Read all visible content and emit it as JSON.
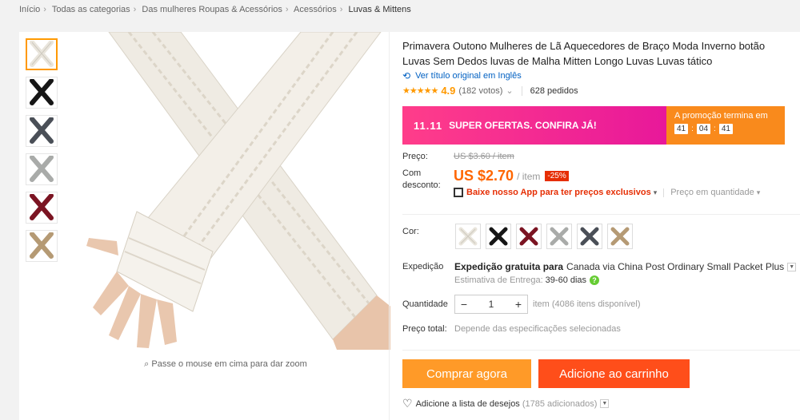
{
  "breadcrumb": {
    "items": [
      "Início",
      "Todas as categorias",
      "Das mulheres Roupas & Acessórios",
      "Acessórios"
    ],
    "current": "Luvas & Mittens",
    "separator": "›"
  },
  "gallery": {
    "thumb_colors": [
      "#f2f0ea",
      "#161616",
      "#4a4f57",
      "#a9aba9",
      "#7b1422",
      "#b59a74"
    ],
    "zoom_hint": "Passe o mouse em cima para dar zoom"
  },
  "product": {
    "title": "Primavera Outono Mulheres de Lã Aquecedores de Braço Moda Inverno botão Luvas Sem Dedos luvas de Malha Mitten Longo Luvas Luvas tático",
    "translate_link": "Ver título original em Inglês",
    "stars": "★★★★★",
    "rating": "4.9",
    "votes": "(182 votos)",
    "orders": "628 pedidos"
  },
  "promo": {
    "badge": "11.11",
    "text": "SUPER OFERTAS. CONFIRA JÁ!",
    "ends_label": "A promoção termina em",
    "countdown": [
      "41",
      "04",
      "41"
    ],
    "accent_pink": "#f0188f",
    "accent_orange": "#f98a1c"
  },
  "price": {
    "label": "Preço:",
    "old": "US $3.60 / item",
    "discount_label": "Com desconto:",
    "new": "US $2.70",
    "per": "/ item",
    "discount": "-25%",
    "app_text": "Baixe nosso App para ter preços exclusivos",
    "qty_price": "Preço em quantidade"
  },
  "options": {
    "color_label": "Cor:",
    "swatches": [
      "#f2f0ea",
      "#161616",
      "#7b1422",
      "#a9aba9",
      "#4a4f57",
      "#b59a74"
    ]
  },
  "shipping": {
    "label": "Expedição",
    "free": "Expedição gratuita para",
    "dest": "Canada via China Post Ordinary Small Packet Plus",
    "estimate_label": "Estimativa de Entrega:",
    "estimate_days": "39-60 dias"
  },
  "quantity": {
    "label": "Quantidade",
    "minus": "−",
    "value": "1",
    "plus": "+",
    "available": "item (4086 itens disponível)"
  },
  "total": {
    "label": "Preço total:",
    "value": "Depende das especificações selecionadas"
  },
  "actions": {
    "buy": "Comprar agora",
    "cart": "Adicione ao carrinho",
    "wishlist": "Adicione a lista de desejos",
    "wishlist_count": "(1785 adicionados)"
  }
}
